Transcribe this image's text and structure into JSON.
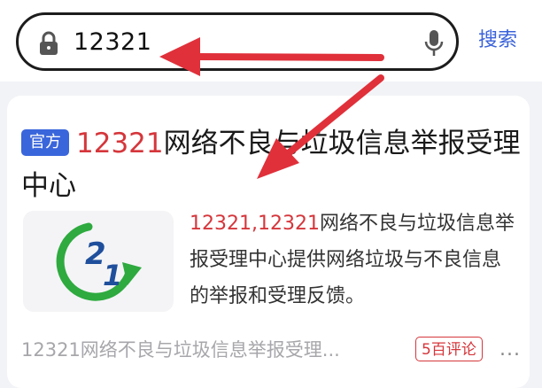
{
  "search": {
    "query": "12321",
    "button_label": "搜索",
    "icons": [
      "lock-icon",
      "microphone-icon"
    ]
  },
  "result": {
    "badge": "官方",
    "title_highlight": "12321",
    "title_rest": "网络不良与垃圾信息举报受理中心",
    "snippet_highlight": "12321,12321",
    "snippet_rest": "网络不良与垃圾信息举报受理中心提供网络垃圾与不良信息的举报和受理反馈。",
    "thumbnail_text": "2 1",
    "source": "12321网络不良与垃圾信息举报受理...",
    "reviews": "5百评论",
    "more": "..."
  },
  "colors": {
    "highlight": "#d5363b",
    "accent_blue": "#3a66db",
    "annotation_arrow": "#e0303a",
    "logo_green": "#2eaa3f",
    "logo_blue": "#1f4f9c"
  }
}
